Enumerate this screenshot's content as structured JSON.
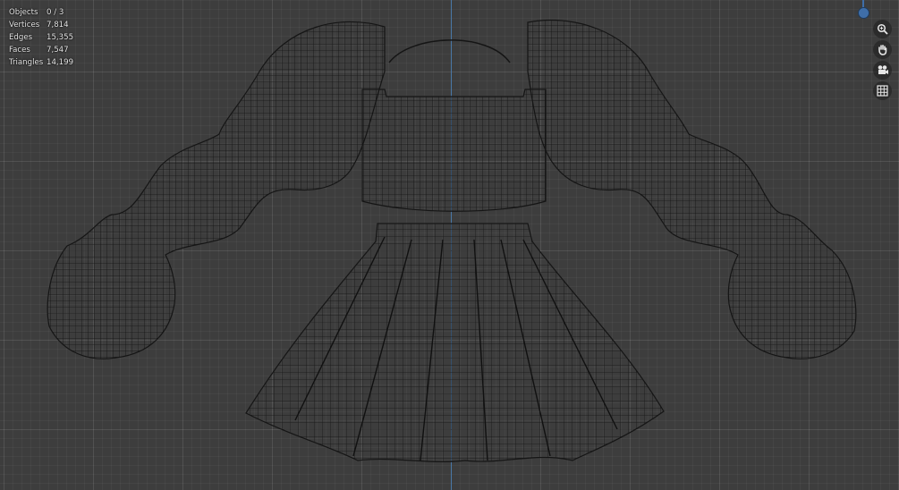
{
  "stats": {
    "objects_label": "Objects",
    "objects_value": "0 / 3",
    "vertices_label": "Vertices",
    "vertices_value": "7,814",
    "edges_label": "Edges",
    "edges_value": "15,355",
    "faces_label": "Faces",
    "faces_value": "7,547",
    "triangles_label": "Triangles",
    "triangles_value": "14,199"
  },
  "viewport": {
    "background_color": "#3d3d3d",
    "wire_color": "#141414",
    "axis_color": "#4a78a8"
  },
  "nav_buttons": [
    {
      "icon": "zoom-icon"
    },
    {
      "icon": "hand-pan-icon"
    },
    {
      "icon": "camera-view-icon"
    },
    {
      "icon": "ortho-grid-icon"
    }
  ]
}
